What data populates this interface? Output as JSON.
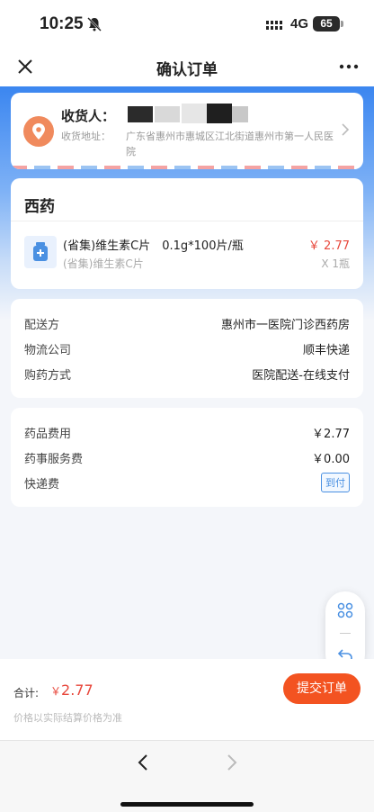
{
  "status_bar": {
    "time": "10:25",
    "network": "4G",
    "battery": "65"
  },
  "nav": {
    "title": "确认订单",
    "close_icon": "close-icon",
    "more_icon": "more-icon"
  },
  "address": {
    "recipient_label": "收货人：",
    "address_label": "收货地址：",
    "address_text": "广东省惠州市惠城区江北街道惠州市第一人民医院"
  },
  "medicine": {
    "section_title": "西药",
    "items": [
      {
        "name": "(省集)维生素C片　0.1g*100片/瓶",
        "subtitle": "(省集)维生素C片",
        "price": "￥ 2.77",
        "quantity": "X 1瓶"
      }
    ]
  },
  "delivery": {
    "rows": [
      {
        "label": "配送方",
        "value": "惠州市一医院门诊西药房"
      },
      {
        "label": "物流公司",
        "value": "顺丰快递"
      },
      {
        "label": "购药方式",
        "value": "医院配送-在线支付"
      }
    ]
  },
  "fees": {
    "drug_fee_label": "药品费用",
    "drug_fee_value": "￥2.77",
    "service_fee_label": "药事服务费",
    "service_fee_value": "￥0.00",
    "shipping_label": "快递费",
    "shipping_tag": "到付"
  },
  "summary": {
    "total_label": "合计:",
    "total_currency": "￥",
    "total_value": "2.77",
    "price_note": "价格以实际结算价格为准",
    "submit_label": "提交订单"
  },
  "colors": {
    "accent": "#f35321",
    "price": "#e8483c",
    "header_gradient_top": "#3b86f0",
    "link": "#4a90e2"
  }
}
